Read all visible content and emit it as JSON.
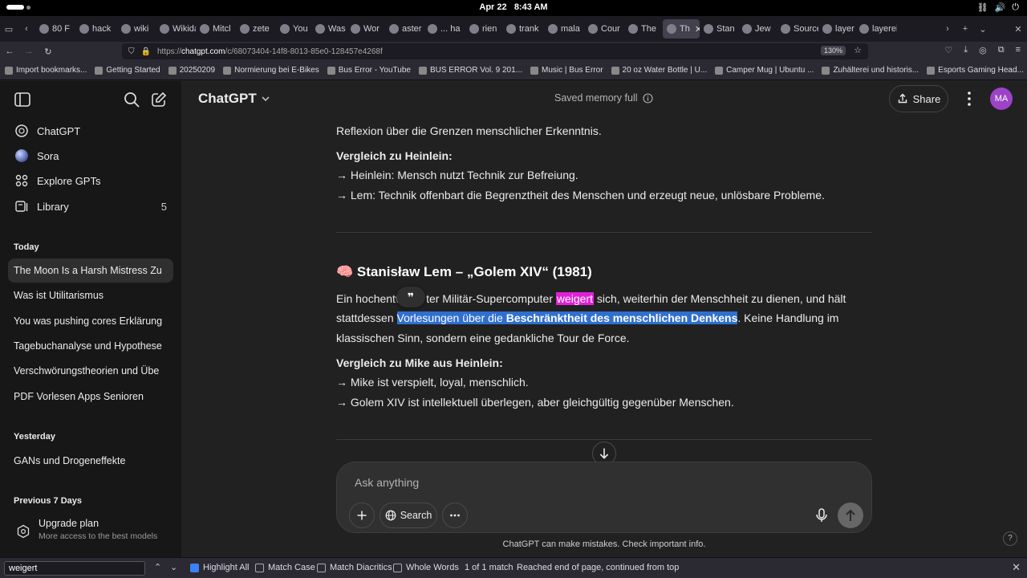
{
  "os": {
    "date": "Apr 22",
    "time": "8:43 AM"
  },
  "tabs": [
    {
      "label": "80 F",
      "icon": "tab-favicon"
    },
    {
      "label": "hack",
      "icon": "google-icon"
    },
    {
      "label": "wiki",
      "icon": "google-icon"
    },
    {
      "label": "Wikidat",
      "icon": "tab-favicon"
    },
    {
      "label": "Mitcl",
      "icon": "x-logo-icon"
    },
    {
      "label": "zete",
      "icon": "google-icon"
    },
    {
      "label": "You",
      "icon": "chatgpt-icon"
    },
    {
      "label": "Was",
      "icon": "chatgpt-icon"
    },
    {
      "label": "Wor",
      "icon": "wikipedia-icon"
    },
    {
      "label": "aster",
      "icon": "google-icon"
    },
    {
      "label": "... ha",
      "icon": "pinterest-icon"
    },
    {
      "label": "rien",
      "icon": "tab-favicon"
    },
    {
      "label": "trank",
      "icon": "google-icon"
    },
    {
      "label": "mala",
      "icon": "google-icon"
    },
    {
      "label": "Cour",
      "icon": "tab-favicon"
    },
    {
      "label": "The",
      "icon": "wikipedia-icon"
    },
    {
      "label": "Th",
      "icon": "chatgpt-icon",
      "active": true
    },
    {
      "label": "Stan",
      "icon": "wikipedia-icon"
    },
    {
      "label": "Jew",
      "icon": "wikipedia-icon"
    },
    {
      "label": "Source",
      "icon": "tab-favicon"
    },
    {
      "label": "layer",
      "icon": "google-icon"
    },
    {
      "label": "layereig",
      "icon": "tab-favicon"
    }
  ],
  "address": {
    "prefix": "https://",
    "domain": "chatgpt.com",
    "path": "/c/68073404-14f8-8013-85e0-128457e4268f",
    "zoom": "130%"
  },
  "bookmarks": [
    "Import bookmarks...",
    "Getting Started",
    "20250209",
    "Normierung bei E-Bikes",
    "Bus Error - YouTube",
    "BUS ERROR Vol. 9 201...",
    "Music | Bus Error",
    "20 oz Water Bottle | U...",
    "Camper Mug | Ubuntu ...",
    "Zuhälterei und historis...",
    "Esports Gaming Head..."
  ],
  "sidebar": {
    "nav": [
      {
        "label": "ChatGPT",
        "icon": "chatgpt-icon"
      },
      {
        "label": "Sora",
        "icon": "sora-icon"
      },
      {
        "label": "Explore GPTs",
        "icon": "grid-icon"
      },
      {
        "label": "Library",
        "icon": "library-icon",
        "count": "5"
      }
    ],
    "today_label": "Today",
    "today": [
      "The Moon Is a Harsh Mistress Zu",
      "Was ist Utilitarismus",
      "You was pushing cores Erklärung",
      "Tagebuchanalyse und Hypothese",
      "Verschwörungstheorien und Übe",
      "PDF Vorlesen Apps Senioren"
    ],
    "yesterday_label": "Yesterday",
    "yesterday": [
      "GANs und Drogeneffekte"
    ],
    "prev_label": "Previous 7 Days",
    "upgrade": {
      "title": "Upgrade plan",
      "subtitle": "More access to the best models"
    }
  },
  "header": {
    "model": "ChatGPT",
    "memory": "Saved memory full",
    "share": "Share",
    "avatar": "MA"
  },
  "content": {
    "line1": "Reflexion über die Grenzen menschlicher Erkenntnis.",
    "cmp1_head": "Vergleich zu Heinlein:",
    "cmp1_a": "→ Heinlein: Mensch nutzt Technik zur Befreiung.",
    "cmp1_b": "→ Lem: Technik offenbart die Begrenztheit des Menschen und erzeugt neue, unlösbare Probleme.",
    "h3_emoji": "🧠",
    "h3": "Stanisław Lem – „Golem XIV“ (1981)",
    "p1_a": "Ein hochentw",
    "p1_b": "ter Militär-Supercomputer ",
    "p1_find": "weigert",
    "p1_c": " sich, weiterhin der Menschheit zu dienen, und hält",
    "p2_a": "stattdessen ",
    "p2_sel": "Vorlesungen über die ",
    "p2_selbold": "Beschränktheit des menschlichen Denkens",
    "p2_b": ". Keine Handlung im",
    "p3": "klassischen Sinn, sondern eine gedankliche Tour de Force.",
    "cmp2_head": "Vergleich zu Mike aus Heinlein:",
    "cmp2_a": "→ Mike ist verspielt, loyal, menschlich.",
    "cmp2_b": "→ Golem XIV ist intellektuell überlegen, aber gleichgültig gegenüber Menschen.",
    "quote_glyph": "❞"
  },
  "composer": {
    "placeholder": "Ask anything",
    "search": "Search"
  },
  "disclaimer": "ChatGPT can make mistakes. Check important info.",
  "findbar": {
    "query": "weigert",
    "highlight_all": "Highlight All",
    "match_case": "Match Case",
    "match_diacritics": "Match Diacritics",
    "whole_words": "Whole Words",
    "result": "1 of 1 match",
    "status": "Reached end of page, continued from top"
  },
  "colors": {
    "find_highlight": "#e11fd8",
    "selection": "#2f6fd0",
    "avatar": "#9c43c7"
  }
}
